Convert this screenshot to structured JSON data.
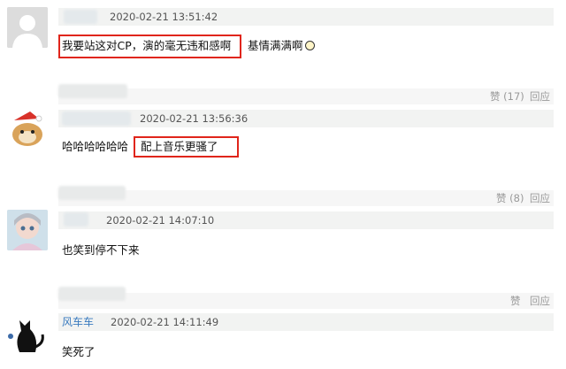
{
  "comments": [
    {
      "username": "",
      "time": "2020-02-21 13:51:42",
      "text_highlighted": "我要站这对CP，演的毫无违和感啊",
      "text_after": "基情满满啊",
      "emoji": "smile-emoji",
      "like_label": "赞 (17)",
      "reply_label": "回应"
    },
    {
      "username": "",
      "time": "2020-02-21 13:56:36",
      "text_before": "哈哈哈哈哈哈",
      "text_highlighted": "配上音乐更骚了",
      "like_label": "赞 (8)",
      "reply_label": "回应"
    },
    {
      "username": "",
      "time": "2020-02-21 14:07:10",
      "text": "也笑到停不下来",
      "like_label": "赞",
      "reply_label": "回应"
    },
    {
      "username": "风车车",
      "time": "2020-02-21 14:11:49",
      "text": "笑死了"
    }
  ],
  "colors": {
    "highlight_border": "#e0251b",
    "username_link": "#3a7bbf",
    "meta_bar": "#f2f3f2",
    "action_text": "#999999"
  }
}
